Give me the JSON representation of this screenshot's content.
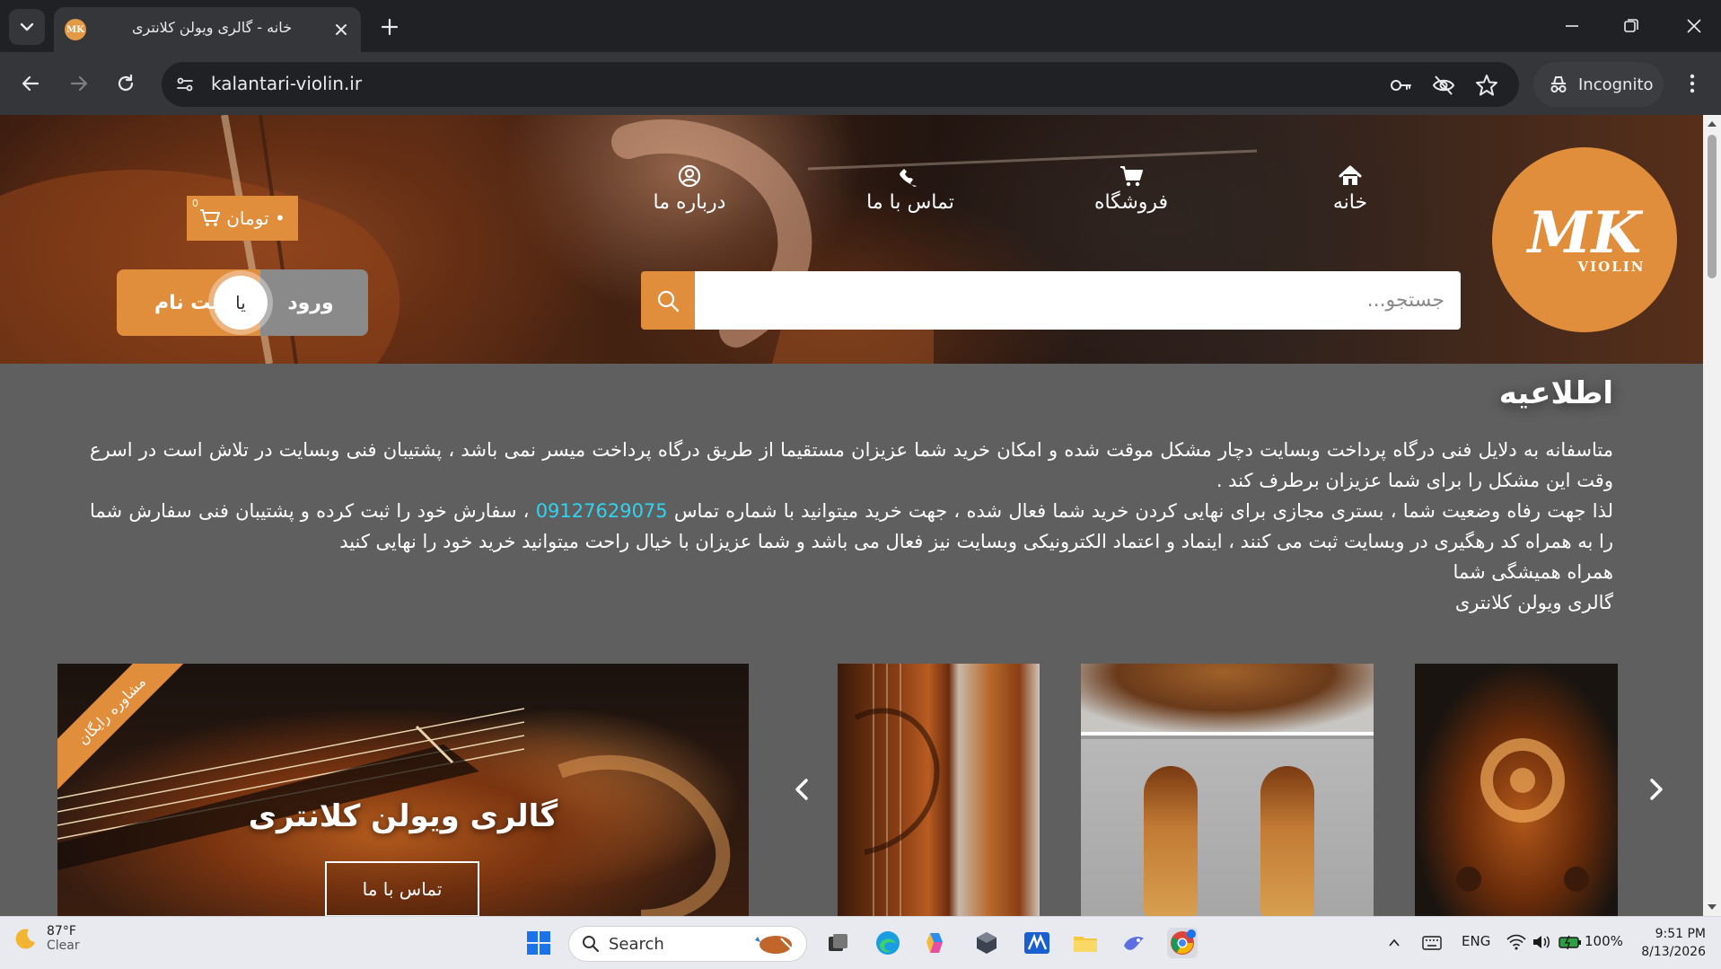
{
  "browser": {
    "tab_title": "خانه - گالری ویولن کلانتری",
    "favicon_text": "MK",
    "url": "kalantari-violin.ir",
    "incognito_label": "Incognito"
  },
  "site": {
    "logo_mark": "MK",
    "logo_sub": "VIOLIN",
    "nav": [
      {
        "label": "خانه",
        "icon": "home-icon"
      },
      {
        "label": "فروشگاه",
        "icon": "cart-icon"
      },
      {
        "label": "تماس با ما",
        "icon": "phone-icon"
      },
      {
        "label": "درباره ما",
        "icon": "user-circle-icon"
      }
    ],
    "search_placeholder": "جستجو...",
    "cart": {
      "count": "0",
      "label": "• تومان"
    },
    "auth": {
      "login": "ورود",
      "or": "یا",
      "register": "ثبت نام"
    },
    "notice": {
      "title": "اطلاعیه",
      "p1": "متاسفانه به دلایل فنی درگاه پرداخت وبسایت دچار مشکل موقت شده و امکان خرید شما عزیزان مستقیما از طریق درگاه پرداخت میسر نمی باشد ، پشتیبان فنی وبسایت در تلاش است در اسرع وقت این مشکل را برای شما عزیزان برطرف کند .",
      "p2_before": "لذا جهت رفاه وضعیت شما ، بستری مجازی برای نهایی کردن خرید شما فعال شده ، جهت خرید میتوانید با شماره تماس",
      "phone": "09127629075",
      "p2_after": "، سفارش خود را ثبت کرده و پشتیبان فنی سفارش شما را به همراه کد رهگیری در وبسایت ثبت می کنند ، اینماد و اعتماد الکترونیکی وبسایت نیز فعال می باشد و شما عزیزان با خیال راحت میتوانید خرید خود را نهایی کنید",
      "p3": "همراه همیشگی شما",
      "p4": "گالری ویولن کلانتری"
    },
    "banner": {
      "ribbon": "مشاوره رایگان",
      "title": "گالری ویولن کلانتری",
      "button": "تماس با ما"
    }
  },
  "taskbar": {
    "weather_temp": "87°F",
    "weather_cond": "Clear",
    "search_label": "Search",
    "lang": "ENG",
    "battery": "100%",
    "time": "9:51 PM",
    "date": "8/13/2026"
  },
  "colors": {
    "accent": "#e08d3c",
    "link": "#2fd4f0",
    "page_bg": "#5f5f5f"
  }
}
